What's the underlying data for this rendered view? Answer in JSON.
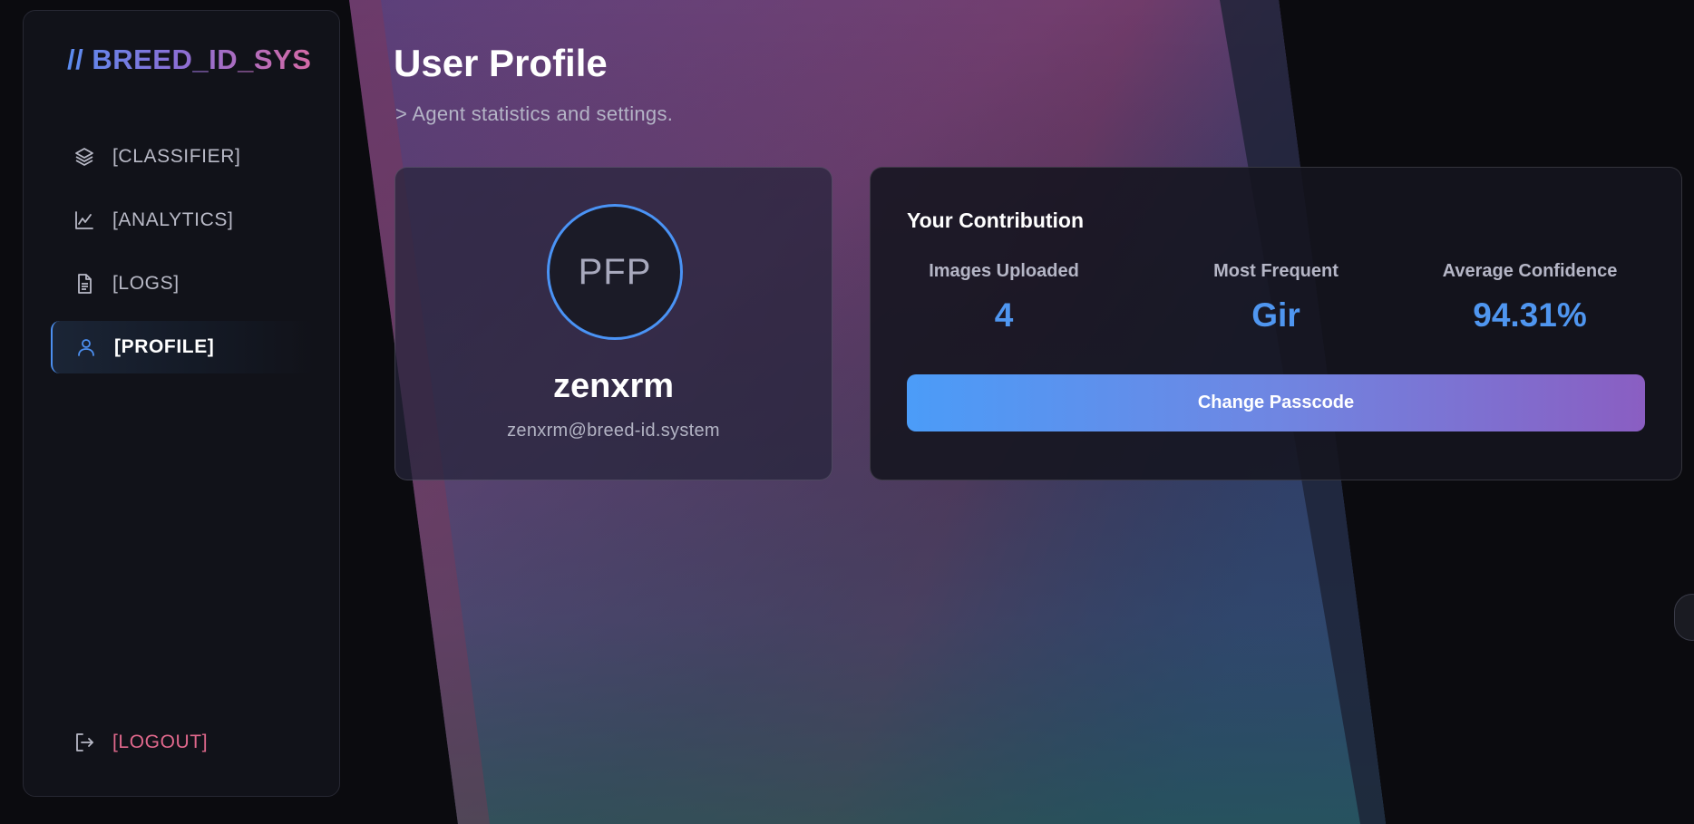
{
  "sidebar": {
    "brand": "// BREED_ID_SYS",
    "items": [
      {
        "label": "[CLASSIFIER]",
        "icon": "layers-icon"
      },
      {
        "label": "[ANALYTICS]",
        "icon": "chart-line-icon"
      },
      {
        "label": "[LOGS]",
        "icon": "document-icon"
      },
      {
        "label": "[PROFILE]",
        "icon": "user-icon",
        "active": true
      }
    ],
    "logout": {
      "label": "[LOGOUT]",
      "icon": "logout-icon"
    }
  },
  "header": {
    "title": "User Profile",
    "subtitle": "> Agent statistics and settings."
  },
  "profile_card": {
    "avatar_text": "PFP",
    "username": "zenxrm",
    "email": "zenxrm@breed-id.system"
  },
  "contribution": {
    "title": "Your Contribution",
    "stats": [
      {
        "label": "Images Uploaded",
        "value": "4"
      },
      {
        "label": "Most Frequent",
        "value": "Gir"
      },
      {
        "label": "Average Confidence",
        "value": "94.31%"
      }
    ],
    "change_passcode_label": "Change Passcode"
  },
  "colors": {
    "accent": "#4f96f0",
    "logout": "#e0688c",
    "background": "#0b0b0f"
  }
}
